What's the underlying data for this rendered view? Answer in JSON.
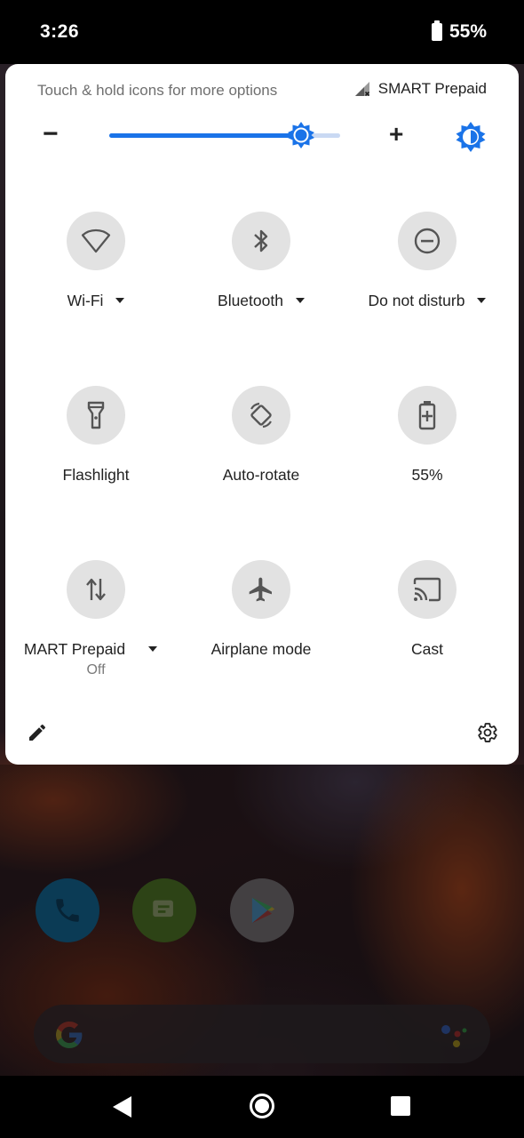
{
  "status_bar": {
    "time": "3:26",
    "battery": "55%"
  },
  "panel": {
    "hint": "Touch & hold icons for more options",
    "carrier": "SMART Prepaid",
    "brightness": {
      "level": 0.83,
      "minus": "−",
      "plus": "+"
    }
  },
  "tiles": [
    {
      "label": "Wi-Fi",
      "icon": "wifi-icon",
      "has_dropdown": true
    },
    {
      "label": "Bluetooth",
      "icon": "bluetooth-icon",
      "has_dropdown": true
    },
    {
      "label": "Do not disturb",
      "icon": "do-not-disturb-icon",
      "has_dropdown": true
    },
    {
      "label": "Flashlight",
      "icon": "flashlight-icon"
    },
    {
      "label": "Auto-rotate",
      "icon": "auto-rotate-icon"
    },
    {
      "label": "55%",
      "icon": "battery-saver-icon"
    },
    {
      "label": "MART Prepaid",
      "sublabel": "Off",
      "icon": "mobile-data-icon",
      "has_dropdown": true
    },
    {
      "label": "Airplane mode",
      "icon": "airplane-icon"
    },
    {
      "label": "Cast",
      "icon": "cast-icon"
    }
  ],
  "colors": {
    "accent": "#1a73e8",
    "tile_bg": "#e2e2e2",
    "panel_bg": "#ffffff"
  }
}
